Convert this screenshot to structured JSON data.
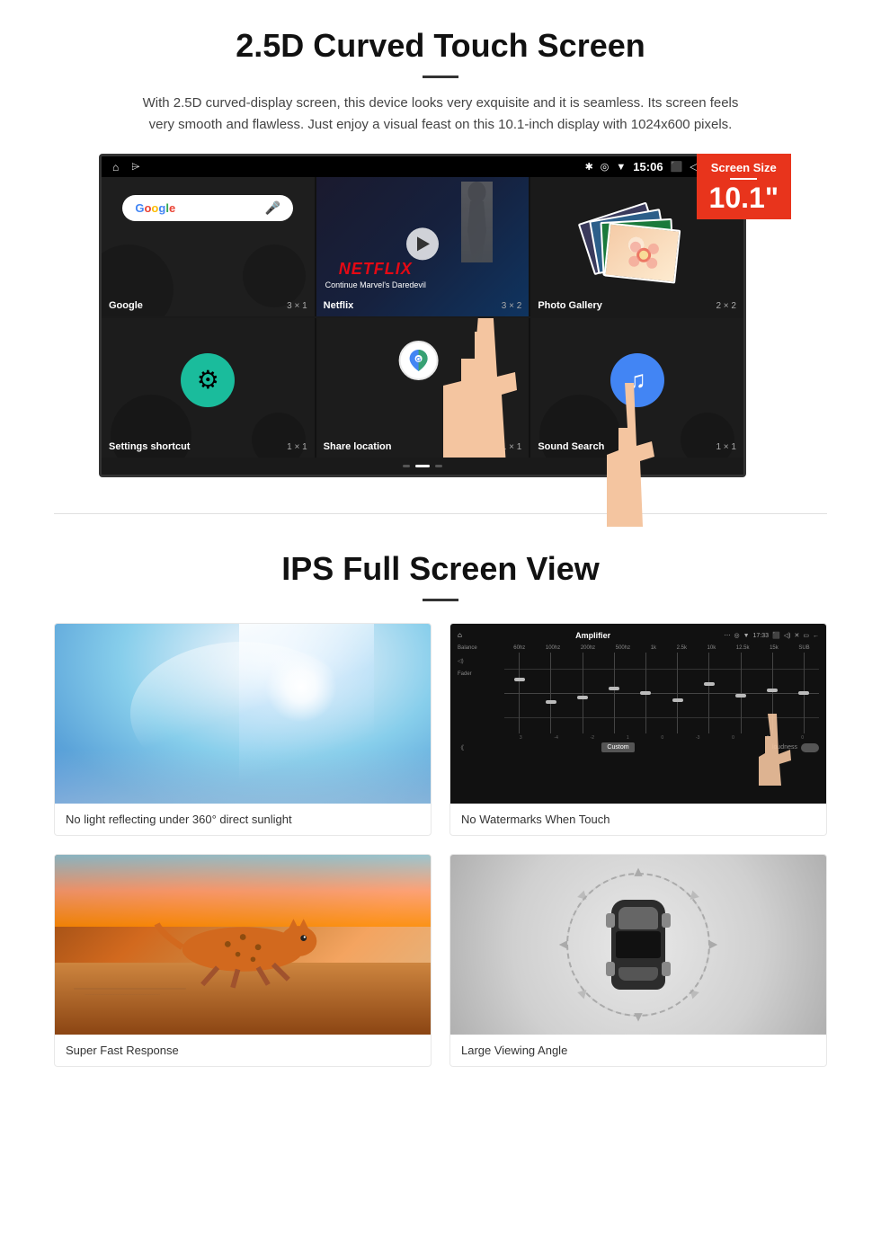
{
  "section1": {
    "title": "2.5D Curved Touch Screen",
    "description": "With 2.5D curved-display screen, this device looks very exquisite and it is seamless. Its screen feels very smooth and flawless. Just enjoy a visual feast on this 10.1-inch display with 1024x600 pixels.",
    "badge": {
      "label": "Screen Size",
      "size": "10.1\""
    },
    "statusBar": {
      "time": "15:06"
    },
    "apps": [
      {
        "name": "Google",
        "size": "3 × 1"
      },
      {
        "name": "Netflix",
        "size": "3 × 2",
        "subtitle": "Continue Marvel's Daredevil"
      },
      {
        "name": "Photo Gallery",
        "size": "2 × 2"
      },
      {
        "name": "Settings shortcut",
        "size": "1 × 1"
      },
      {
        "name": "Share location",
        "size": "1 × 1"
      },
      {
        "name": "Sound Search",
        "size": "1 × 1"
      }
    ]
  },
  "section2": {
    "title": "IPS Full Screen View",
    "images": [
      {
        "id": "sunlight",
        "caption": "No light reflecting under 360° direct sunlight"
      },
      {
        "id": "amplifier",
        "caption": "No Watermarks When Touch"
      },
      {
        "id": "cheetah",
        "caption": "Super Fast Response"
      },
      {
        "id": "car",
        "caption": "Large Viewing Angle"
      }
    ]
  },
  "icons": {
    "home": "⌂",
    "usb": "⌲",
    "bluetooth": "✱",
    "location": "⊙",
    "wifi": "▼",
    "camera": "📷",
    "volume": "◁)",
    "close": "✕",
    "window": "⬜",
    "settings_gear": "⚙",
    "music_note": "♫",
    "play": "▶"
  }
}
